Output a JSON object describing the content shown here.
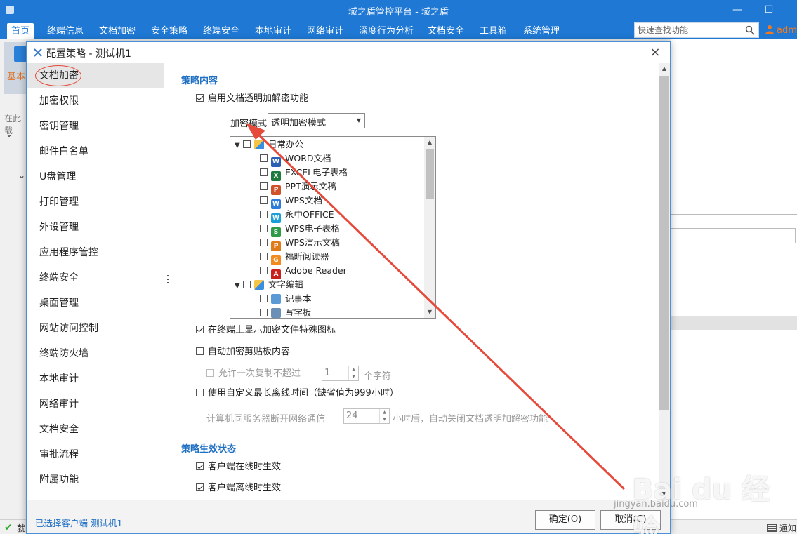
{
  "app": {
    "title": "域之盾管控平台 - 域之盾",
    "minimize": "—",
    "maximize": "☐"
  },
  "nav": {
    "items": [
      "首页",
      "终端信息",
      "文档加密",
      "安全策略",
      "终端安全",
      "本地审计",
      "网络审计",
      "深度行为分析",
      "文档安全",
      "工具箱",
      "系统管理"
    ],
    "active_index": 0,
    "search_placeholder": "快速查找功能",
    "user": "adm"
  },
  "background": {
    "toolbar_label": "基本",
    "search_text": "在此载",
    "status_text": "就",
    "notify_text": "通知"
  },
  "dialog": {
    "title": "配置策略 - 测试机1",
    "close": "×",
    "menu": [
      "文档加密",
      "加密权限",
      "密钥管理",
      "邮件白名单",
      "U盘管理",
      "打印管理",
      "外设管理",
      "应用程序管控",
      "终端安全",
      "桌面管理",
      "网站访问控制",
      "终端防火墙",
      "本地审计",
      "网络审计",
      "文档安全",
      "审批流程",
      "附属功能"
    ],
    "active_menu_index": 0,
    "content": {
      "section1_title": "策略内容",
      "enable_transparent": "启用文档透明加解密功能",
      "enable_transparent_checked": true,
      "mode_label": "加密模式",
      "mode_value": "透明加密模式",
      "tree": [
        {
          "label": "日常办公",
          "level": 0,
          "icon": "folder-office-icon"
        },
        {
          "label": "WORD文档",
          "level": 1,
          "icon": "word-icon",
          "color": "#2b5fb4",
          "glyph": "W"
        },
        {
          "label": "EXCEL电子表格",
          "level": 1,
          "icon": "excel-icon",
          "color": "#1f7a3d",
          "glyph": "X"
        },
        {
          "label": "PPT演示文稿",
          "level": 1,
          "icon": "ppt-icon",
          "color": "#d0522a",
          "glyph": "P"
        },
        {
          "label": "WPS文档",
          "level": 1,
          "icon": "wps-writer-icon",
          "color": "#2f7bd8",
          "glyph": "W"
        },
        {
          "label": "永中OFFICE",
          "level": 1,
          "icon": "yozo-icon",
          "color": "#1aa0d8",
          "glyph": "W"
        },
        {
          "label": "WPS电子表格",
          "level": 1,
          "icon": "wps-sheet-icon",
          "color": "#2e9b46",
          "glyph": "S"
        },
        {
          "label": "WPS演示文稿",
          "level": 1,
          "icon": "wps-presentation-icon",
          "color": "#e07b1a",
          "glyph": "P"
        },
        {
          "label": "福昕阅读器",
          "level": 1,
          "icon": "foxit-icon",
          "color": "#f28a1e",
          "glyph": "G"
        },
        {
          "label": "Adobe Reader",
          "level": 1,
          "icon": "adobe-reader-icon",
          "color": "#c8201c",
          "glyph": "A"
        },
        {
          "label": "文字编辑",
          "level": 0,
          "icon": "folder-text-icon"
        },
        {
          "label": "记事本",
          "level": 1,
          "icon": "notepad-icon",
          "color": "#5b9bd5",
          "glyph": ""
        },
        {
          "label": "写字板",
          "level": 1,
          "icon": "wordpad-icon",
          "color": "#6c8fb8",
          "glyph": ""
        }
      ],
      "show_icon": "在终端上显示加密文件特殊图标",
      "show_icon_checked": true,
      "auto_clipboard": "自动加密剪贴板内容",
      "auto_clipboard_checked": false,
      "allow_copy": "允许一次复制不超过",
      "allow_copy_value": "1",
      "allow_copy_unit": "个字符",
      "custom_offline": "使用自定义最长离线时间（缺省值为999小时）",
      "custom_offline_checked": false,
      "offline_prefix": "计算机同服务器断开网络通信",
      "offline_value": "24",
      "offline_suffix": "小时后，自动关闭文档透明加解密功能",
      "section2_title": "策略生效状态",
      "online_effect": "客户端在线时生效",
      "online_effect_checked": true,
      "offline_effect": "客户端离线时生效",
      "offline_effect_checked": true
    },
    "footer": {
      "selected": "已选择客户端 测试机1",
      "ok": "确定(O)",
      "cancel": "取消(C)"
    }
  },
  "watermark": {
    "main": "Bai du 经验",
    "sub": "jingyan.baidu.com"
  },
  "colors": {
    "brand": "#1e78d4",
    "section": "#1f6fc4",
    "annotation": "#e54a3a",
    "highlight_text": "#f07a20"
  }
}
